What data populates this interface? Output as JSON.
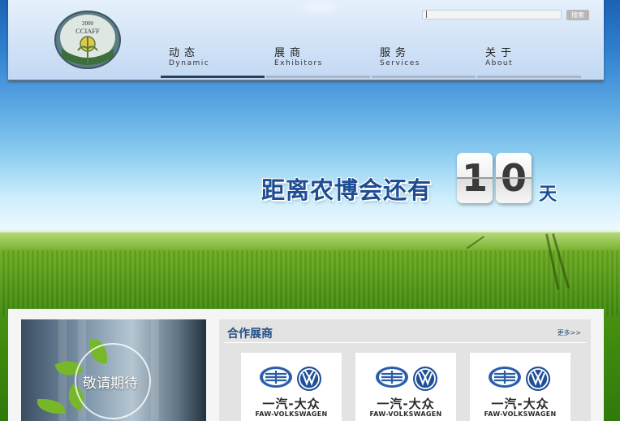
{
  "header": {
    "logo": {
      "year": "2000",
      "acronym": "CCIAFF"
    },
    "search": {
      "value": "|",
      "button_label": "搜索"
    },
    "nav": [
      {
        "cn": "动态",
        "en": "Dynamic",
        "active": true
      },
      {
        "cn": "展商",
        "en": "Exhibitors",
        "active": false
      },
      {
        "cn": "服务",
        "en": "Services",
        "active": false
      },
      {
        "cn": "关于",
        "en": "About",
        "active": false
      }
    ]
  },
  "banner": {
    "countdown_prefix": "距离农博会还有",
    "countdown_days": [
      "1",
      "0"
    ],
    "countdown_suffix": "天"
  },
  "promo": {
    "text": "敬请期待"
  },
  "partners": {
    "title": "合作展商",
    "more": "更多>>",
    "items": [
      {
        "wordmark": "一汽-大众",
        "sub": "FAW-VOLKSWAGEN"
      },
      {
        "wordmark": "一汽-大众",
        "sub": "FAW-VOLKSWAGEN"
      },
      {
        "wordmark": "一汽-大众",
        "sub": "FAW-VOLKSWAGEN"
      }
    ]
  },
  "colors": {
    "brand_blue": "#1d4d93",
    "nav_active": "#2b3c55",
    "partner_title": "#244f86"
  }
}
